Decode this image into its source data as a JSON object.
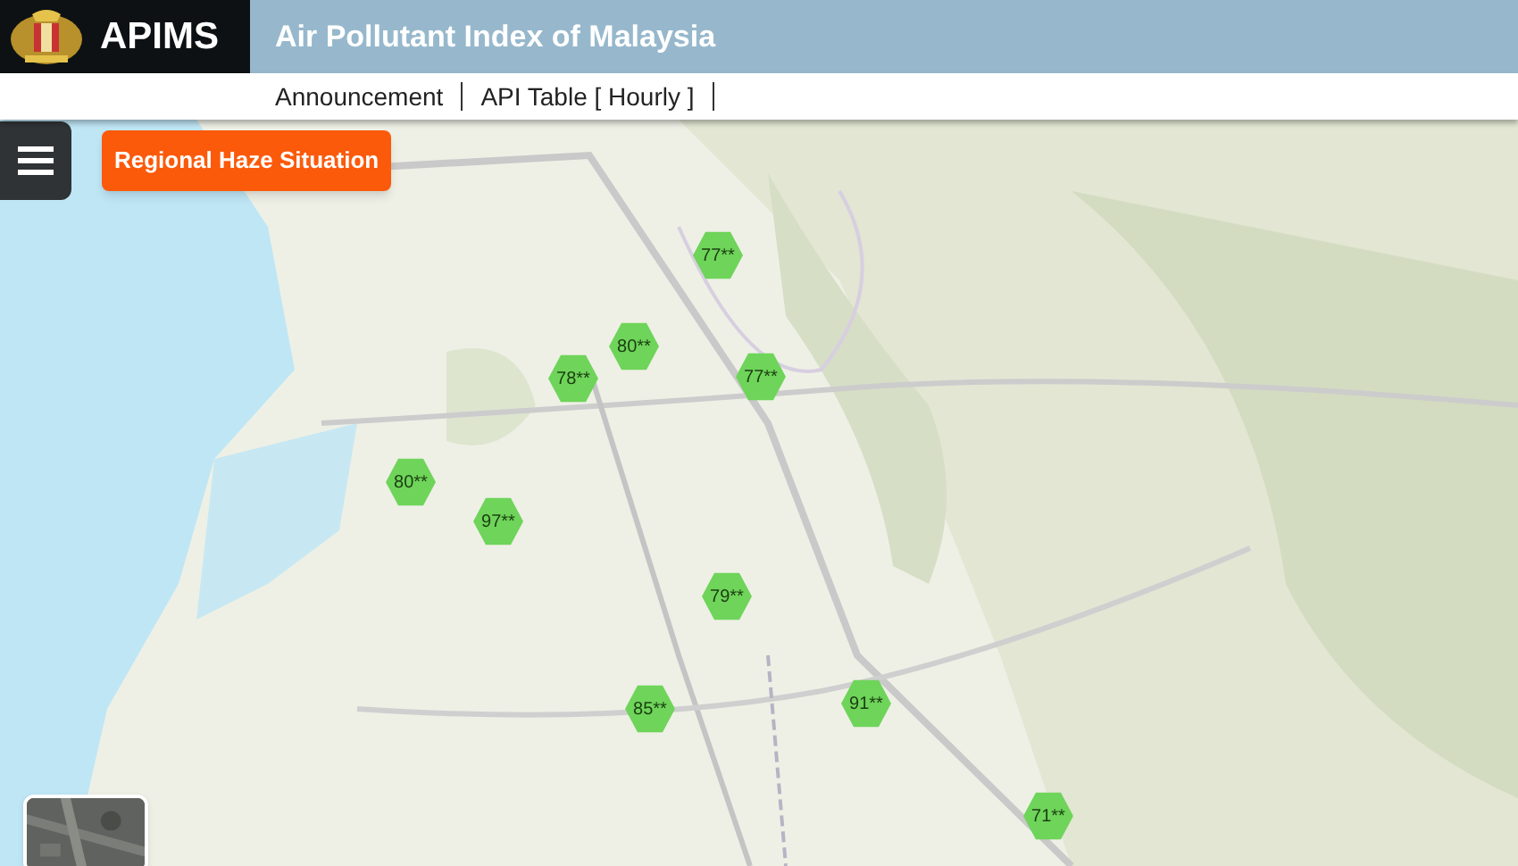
{
  "header": {
    "brand": "APIMS",
    "title": "Air Pollutant Index of Malaysia"
  },
  "nav": [
    {
      "label": "Announcement"
    },
    {
      "label": "API Table [ Hourly ]"
    }
  ],
  "map": {
    "haze_button": "Regional Haze Situation",
    "markers": [
      {
        "value": "77**",
        "color": "#6fd45a"
      },
      {
        "value": "80**",
        "color": "#6fd45a"
      },
      {
        "value": "78**",
        "color": "#6fd45a"
      },
      {
        "value": "77**",
        "color": "#6fd45a"
      },
      {
        "value": "80**",
        "color": "#6fd45a"
      },
      {
        "value": "97**",
        "color": "#6fd45a"
      },
      {
        "value": "79**",
        "color": "#6fd45a"
      },
      {
        "value": "85**",
        "color": "#6fd45a"
      },
      {
        "value": "91**",
        "color": "#6fd45a"
      },
      {
        "value": "71**",
        "color": "#6fd45a"
      }
    ]
  }
}
